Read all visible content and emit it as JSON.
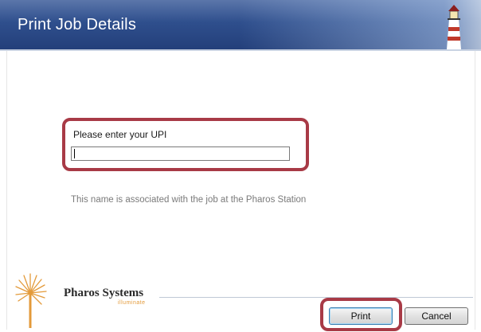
{
  "window": {
    "title": "Print Job Details"
  },
  "form": {
    "prompt_label": "Please enter your UPI",
    "upi_value": "",
    "hint": "This name is associated with the job at the Pharos Station"
  },
  "branding": {
    "name": "Pharos Systems",
    "tagline": "illuminate",
    "logo_icon": "sunburst-logo-icon",
    "lighthouse_icon": "lighthouse-icon"
  },
  "buttons": {
    "print_label": "Print",
    "cancel_label": "Cancel"
  },
  "colors": {
    "banner": "#2f4f8d",
    "highlight": "#a83a46",
    "logo_orange": "#e39a3a"
  }
}
